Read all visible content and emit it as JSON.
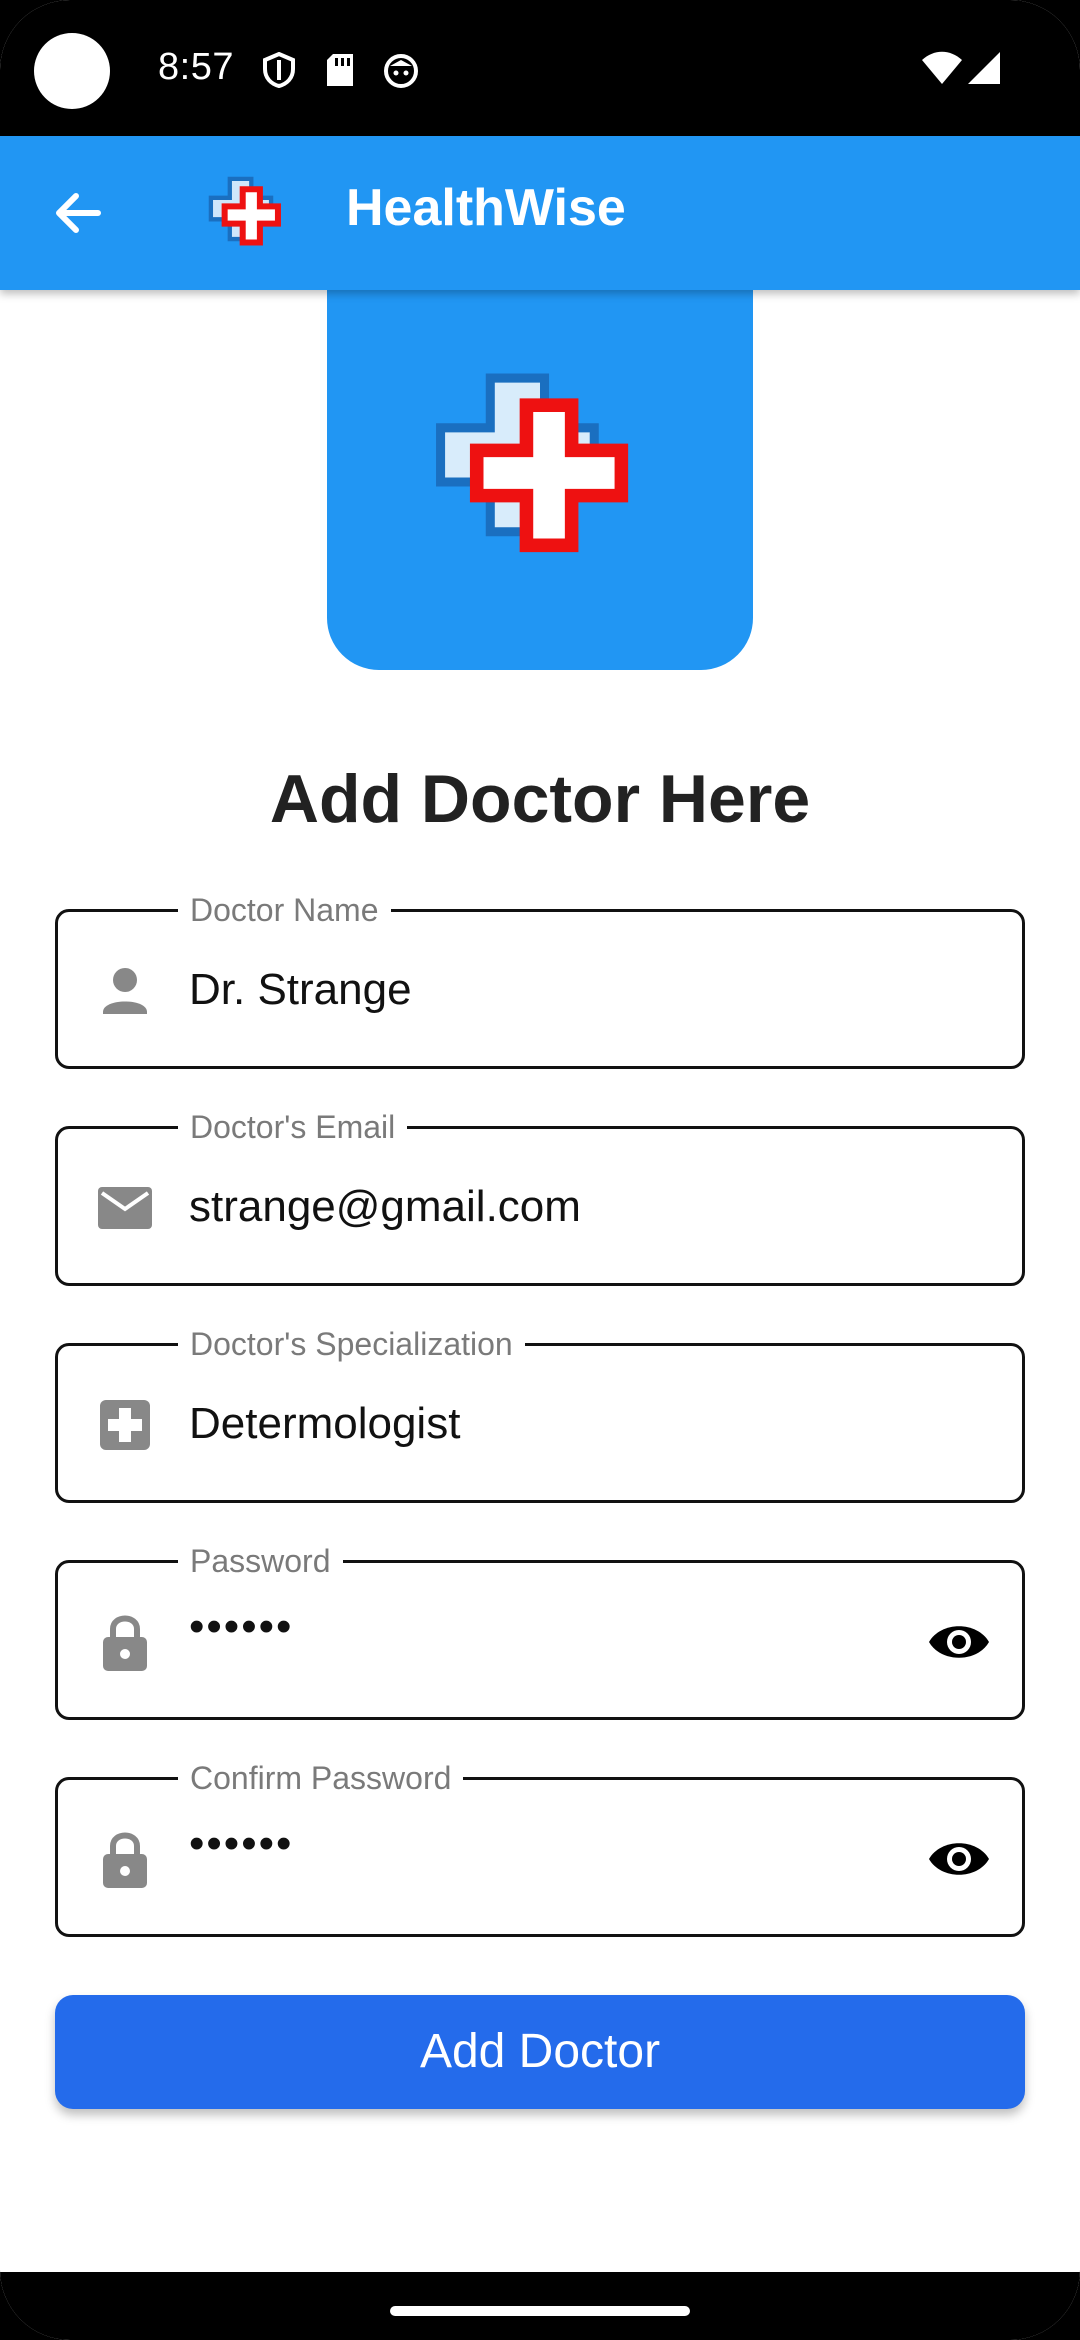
{
  "status_bar": {
    "time": "8:57",
    "left_icons": [
      "shield-icon",
      "sd-card-icon",
      "cat-face-icon"
    ],
    "right_icons": [
      "wifi-icon",
      "signal-icon"
    ]
  },
  "app_bar": {
    "title": "HealthWise",
    "back_icon": "arrow-back-icon",
    "logo_icon": "medical-cross-logo",
    "color": "#2196F3"
  },
  "page": {
    "title": "Add Doctor Here"
  },
  "form": {
    "fields": [
      {
        "label": "Doctor Name",
        "value": "Dr. Strange",
        "icon": "person-icon"
      },
      {
        "label": "Doctor's Email",
        "value": "strange@gmail.com",
        "icon": "mail-icon"
      },
      {
        "label": "Doctor's Specialization",
        "value": "Determologist",
        "icon": "medical-plus-icon"
      },
      {
        "label": "Password",
        "value": "••••••",
        "icon": "lock-icon",
        "trailing_icon": "eye-icon"
      },
      {
        "label": "Confirm Password",
        "value": "••••••",
        "icon": "lock-icon",
        "trailing_icon": "eye-icon"
      }
    ],
    "submit_label": "Add Doctor",
    "submit_color": "#246BEB"
  }
}
